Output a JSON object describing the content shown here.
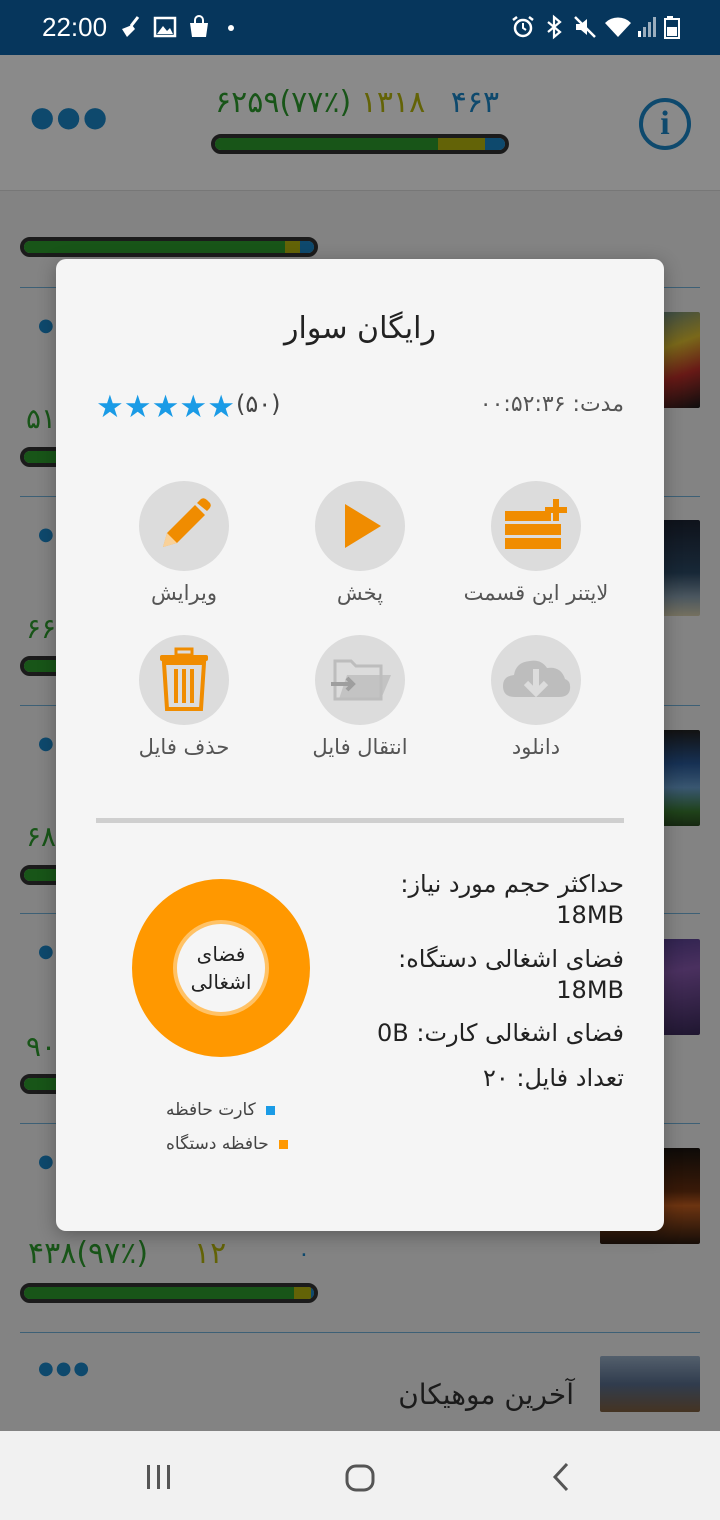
{
  "status_bar": {
    "time": "22:00"
  },
  "header": {
    "stats": {
      "total": "۶۲۵۹(۷۷٪)",
      "yellow": "۱۳۱۸",
      "blue": "۴۶۳"
    },
    "progress": {
      "green": 0.77,
      "yellow": 0.16,
      "blue": 0.07
    }
  },
  "background_rows": [
    {
      "left_number": "۵۱"
    },
    {
      "left_number": "۶۶"
    },
    {
      "left_number": "۶۸"
    },
    {
      "left_number": "۹۰"
    }
  ],
  "bottom_row": {
    "stat_green": "۴۳۸(۹۷٪)",
    "stat_yellow": "۱۲",
    "stat_blue": "۰",
    "title": "آخرین موهیکان",
    "progress": {
      "green": 0.93,
      "yellow": 0.06,
      "blue": 0.01
    }
  },
  "dialog": {
    "title": "رایگان سوار",
    "rating_stars": 5,
    "rating_count": "(۵۰)",
    "duration_label": "مدت:",
    "duration_value": "۰۰:۵۲:۳۶",
    "actions": [
      {
        "label": "ویرایش",
        "icon": "pencil-icon",
        "color": "#f08c00"
      },
      {
        "label": "پخش",
        "icon": "play-icon",
        "color": "#f08c00"
      },
      {
        "label": "لایتنر این قسمت",
        "icon": "add-to-box-icon",
        "color": "#f08c00"
      },
      {
        "label": "حذف فایل",
        "icon": "trash-icon",
        "color": "#f08c00"
      },
      {
        "label": "انتقال فایل",
        "icon": "folder-move-icon",
        "color": "#bdbdbd"
      },
      {
        "label": "دانلود",
        "icon": "cloud-download-icon",
        "color": "#bdbdbd"
      }
    ],
    "info": {
      "max_size_label": "حداکثر حجم مورد نیاز:",
      "max_size_value": "18MB",
      "device_used_label": "فضای اشغالی دستگاه:",
      "device_used_value": "18MB",
      "card_used_label": "فضای اشغالی کارت:",
      "card_used_value": "0B",
      "file_count_label": "تعداد فایل:",
      "file_count_value": "۲۰"
    },
    "donut_label_line1": "فضای",
    "donut_label_line2": "اشغالی",
    "legend": [
      {
        "label": "کارت حافظه",
        "color": "#1a9be6"
      },
      {
        "label": "حافظه دستگاه",
        "color": "#ff9800"
      }
    ]
  }
}
